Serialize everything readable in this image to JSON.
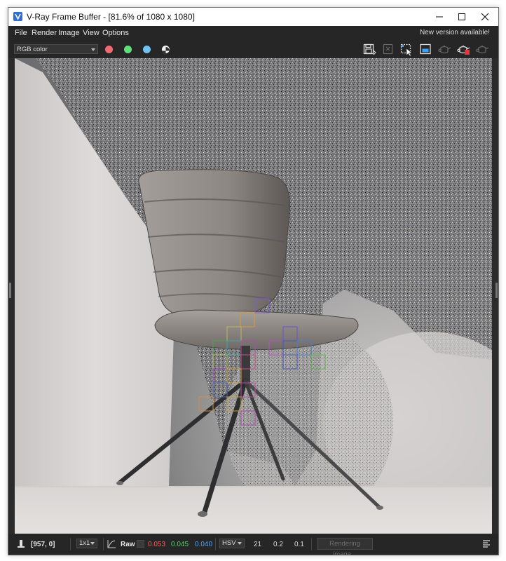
{
  "window": {
    "title": "V-Ray Frame Buffer - [81.6% of 1080 x 1080]",
    "controls": [
      "minimize",
      "maximize",
      "close"
    ]
  },
  "menu": {
    "items": [
      {
        "label": "File"
      },
      {
        "label": "Render"
      },
      {
        "label": "Image"
      },
      {
        "label": "View"
      },
      {
        "label": "Options"
      }
    ],
    "notice": "New version available!"
  },
  "toolbar": {
    "channel_select": "RGB color",
    "color_dots": [
      {
        "name": "red-channel-toggle",
        "color": "#f06a72"
      },
      {
        "name": "green-channel-toggle",
        "color": "#5ee07a"
      },
      {
        "name": "blue-channel-toggle",
        "color": "#6ec3f2"
      }
    ],
    "icons": [
      "save-icon",
      "clear-image-icon",
      "region-render-icon",
      "track-mouse-icon",
      "render-teapot-icon",
      "stop-render-teapot-icon",
      "render-interactive-teapot-icon"
    ]
  },
  "viewport": {
    "image": "chair render in progress",
    "colors": {
      "wall_left": "#d6d3d2",
      "wall_right": "#9b9b9b",
      "floor": "#dcd9d7",
      "chair": "#8c8783"
    }
  },
  "status": {
    "coords": "[957, 0]",
    "zoom": "1x1",
    "mode": "Raw",
    "r": "0.053",
    "g": "0.045",
    "b": "0.040",
    "colorspace": "HSV",
    "h": "21",
    "s": "0.2",
    "v": "0.1",
    "progress_label": "Rendering image...",
    "colors": {
      "r": "#ff5a5a",
      "g": "#4fd06b",
      "b": "#4ea3ff"
    }
  }
}
